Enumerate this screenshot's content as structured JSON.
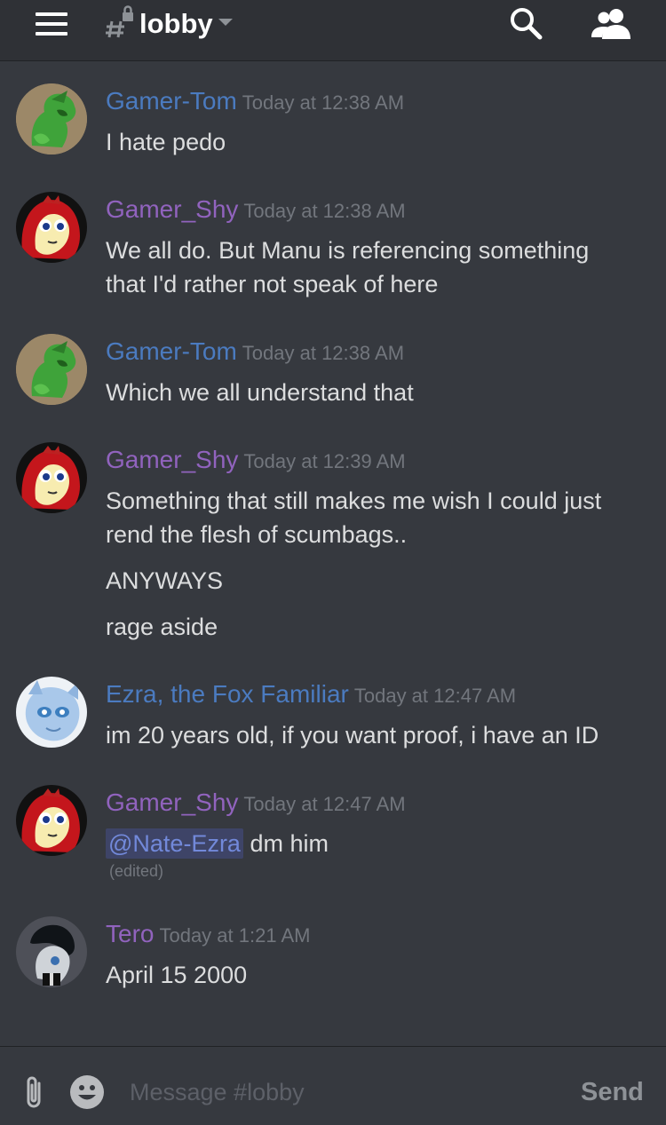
{
  "header": {
    "channel_name": "lobby",
    "icons": {
      "menu": "hamburger-menu-icon",
      "channel": "locked-hash-icon",
      "dropdown": "chevron-down-icon",
      "search": "search-icon",
      "members": "members-icon"
    }
  },
  "colors": {
    "background": "#36393f",
    "topbar": "#2f3136",
    "blue_author": "#4b7bc0",
    "purple_author": "#9163be",
    "timestamp": "#72767d",
    "text": "#dcddde",
    "mention_bg": "#3e4467",
    "mention_text": "#7289da"
  },
  "messages": [
    {
      "author": "Gamer-Tom",
      "author_color": "#4b7bc0",
      "avatar": "green-pony-avatar",
      "timestamp": "Today at 12:38 AM",
      "lines": [
        "I hate pedo"
      ]
    },
    {
      "author": "Gamer_Shy",
      "author_color": "#9163be",
      "avatar": "yellow-red-pony-avatar",
      "timestamp": "Today at 12:38 AM",
      "lines": [
        "We all do. But Manu is referencing something",
        "that I'd rather not speak of here"
      ]
    },
    {
      "author": "Gamer-Tom",
      "author_color": "#4b7bc0",
      "avatar": "green-pony-avatar",
      "timestamp": "Today at 12:38 AM",
      "lines": [
        "Which we all understand that"
      ]
    },
    {
      "author": "Gamer_Shy",
      "author_color": "#9163be",
      "avatar": "yellow-red-pony-avatar",
      "timestamp": "Today at 12:39 AM",
      "lines": [
        "Something that still makes me wish I could just",
        "rend the flesh of scumbags..",
        "ANYWAYS",
        "rage aside"
      ]
    },
    {
      "author": "Ezra, the Fox Familiar",
      "author_color": "#4b7bc0",
      "avatar": "blue-fox-avatar",
      "timestamp": "Today at 12:47 AM",
      "lines": [
        "im 20 years old, if you want proof, i have an ID"
      ]
    },
    {
      "author": "Gamer_Shy",
      "author_color": "#9163be",
      "avatar": "yellow-red-pony-avatar",
      "timestamp": "Today at 12:47 AM",
      "mention": "@Nate-Ezra",
      "lines": [
        " dm him"
      ],
      "edited": "(edited)"
    },
    {
      "author": "Tero",
      "author_color": "#9163be",
      "avatar": "dark-pony-avatar",
      "timestamp": "Today at 1:21 AM",
      "lines": [
        "April 15 2000"
      ]
    }
  ],
  "composer": {
    "placeholder": "Message #lobby",
    "send_label": "Send",
    "icons": {
      "attach": "paperclip-icon",
      "emoji": "emoji-icon"
    }
  }
}
